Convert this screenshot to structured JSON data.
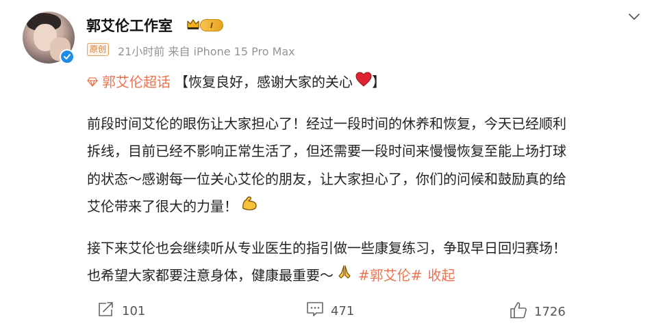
{
  "post": {
    "author": "郭艾伦工作室",
    "member_level": "I",
    "original_tag": "原创",
    "time": "21小时前",
    "source": "来自 iPhone 15 Pro Max",
    "super_topic": "郭艾伦超话",
    "headline": "【恢复良好，感谢大家的关心",
    "headline_end": "】",
    "para1_lines": [
      "前段时间艾伦的眼伤让大家担心了！经过一段时间的休养和恢复，今天已经顺利",
      "拆线，目前已经不影响正常生活了，但还需要一段时间来慢慢恢复至能上场打球",
      "的状态～感谢每一位关心艾伦的朋友，让大家担心了，你们的问候和鼓励真的给",
      "艾伦带来了很大的力量！"
    ],
    "para2_lines": [
      "接下来艾伦也会继续听从专业医生的指引做一些康复练习，争取早日回归赛场！",
      "也希望大家都要注意身体，健康最重要～"
    ],
    "hashtag": "#郭艾伦#",
    "collapse": "收起"
  },
  "actions": {
    "repost_count": "101",
    "comment_count": "471",
    "like_count": "1726"
  },
  "icons": [
    "chevron-down-icon",
    "crown-icon",
    "verified-icon",
    "super-topic-icon",
    "heart-icon",
    "flexed-biceps-icon",
    "folded-hands-icon",
    "repost-icon",
    "comment-icon",
    "like-icon"
  ],
  "colors": {
    "link": "#eb7350",
    "verified": "#1e8be6",
    "text": "#222222",
    "meta": "#939393"
  }
}
